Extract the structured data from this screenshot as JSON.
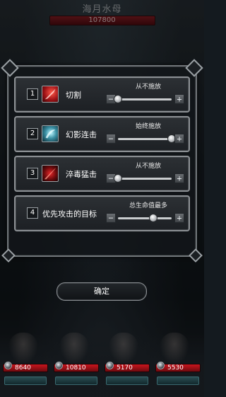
{
  "boss": {
    "name": "海月水母",
    "hp": "107800"
  },
  "skills": [
    {
      "index": "1",
      "name": "切割",
      "condition": "从不施放",
      "slider_level": 0.0,
      "icon": "slash-red-icon"
    },
    {
      "index": "2",
      "name": "幻影连击",
      "condition": "始终施放",
      "slider_level": 1.0,
      "icon": "phantom-slash-icon"
    },
    {
      "index": "3",
      "name": "淬毒猛击",
      "condition": "从不施放",
      "slider_level": 0.0,
      "icon": "poison-strike-icon"
    },
    {
      "index": "4",
      "name": "优先攻击的目标",
      "condition": "总生命值最多",
      "slider_level": 0.66,
      "icon": ""
    }
  ],
  "controls": {
    "minus": "−",
    "plus": "+"
  },
  "confirm_label": "确定",
  "party": [
    {
      "hp": "8640"
    },
    {
      "hp": "10810"
    },
    {
      "hp": "5170"
    },
    {
      "hp": "5530"
    }
  ]
}
